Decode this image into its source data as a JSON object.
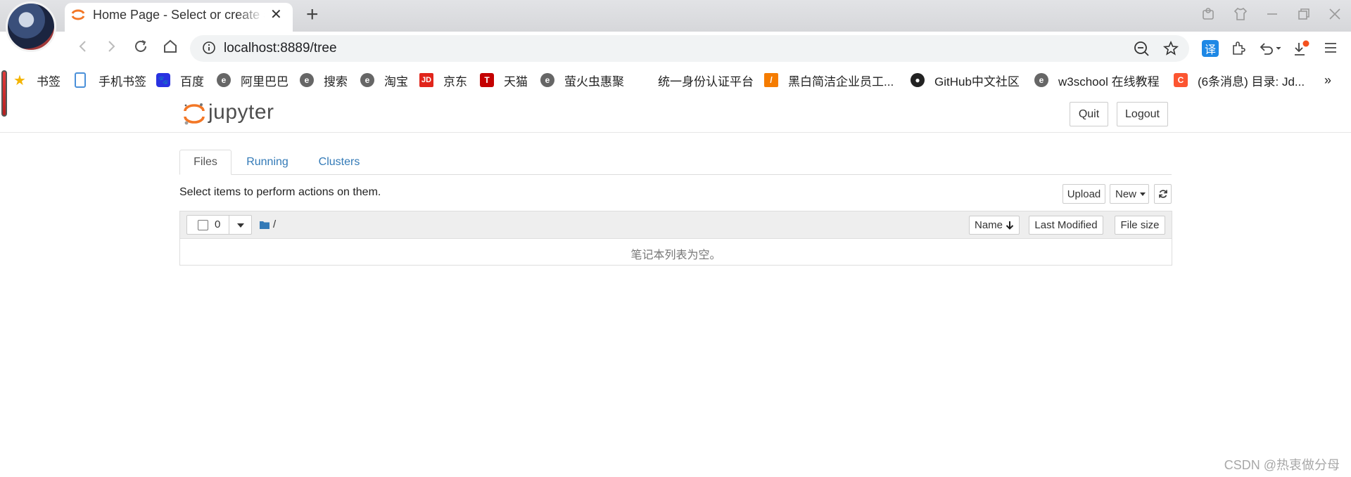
{
  "browser": {
    "tab_title": "Home Page - Select or create a notebook",
    "url": "localhost:8889/tree",
    "bookmarks": [
      {
        "label": "书签",
        "icon": "star-icon"
      },
      {
        "label": "手机书签",
        "icon": "phone-icon"
      },
      {
        "label": "百度",
        "icon": "baidu-paw-icon"
      },
      {
        "label": "阿里巴巴",
        "icon": "edge-icon"
      },
      {
        "label": "搜索",
        "icon": "edge-icon"
      },
      {
        "label": "淘宝",
        "icon": "edge-icon"
      },
      {
        "label": "京东",
        "icon": "jd-icon"
      },
      {
        "label": "天猫",
        "icon": "tmall-icon"
      },
      {
        "label": "萤火虫惠聚",
        "icon": "edge-icon"
      },
      {
        "label": "统一身份认证平台",
        "icon": ""
      },
      {
        "label": "黑白简洁企业员工...",
        "icon": "orange-doc-icon"
      },
      {
        "label": "GitHub中文社区",
        "icon": "github-icon"
      },
      {
        "label": "w3school 在线教程",
        "icon": "edge-icon"
      },
      {
        "label": "(6条消息) 目录: Jd...",
        "icon": "csdn-icon"
      }
    ],
    "translate_label": "译",
    "more_bookmarks": "»"
  },
  "jupyter": {
    "logo_text": "jupyter",
    "quit_label": "Quit",
    "logout_label": "Logout",
    "tabs": [
      {
        "label": "Files",
        "active": true
      },
      {
        "label": "Running",
        "active": false
      },
      {
        "label": "Clusters",
        "active": false
      }
    ],
    "hint": "Select items to perform actions on them.",
    "upload_label": "Upload",
    "new_label": "New",
    "selected_count": "0",
    "path": "/",
    "columns": {
      "name": "Name",
      "last_modified": "Last Modified",
      "file_size": "File size"
    },
    "empty_message": "笔记本列表为空。"
  },
  "colors": {
    "jupyter_orange": "#f37726",
    "link_blue": "#337ab7"
  },
  "watermark": "CSDN @热衷做分母"
}
